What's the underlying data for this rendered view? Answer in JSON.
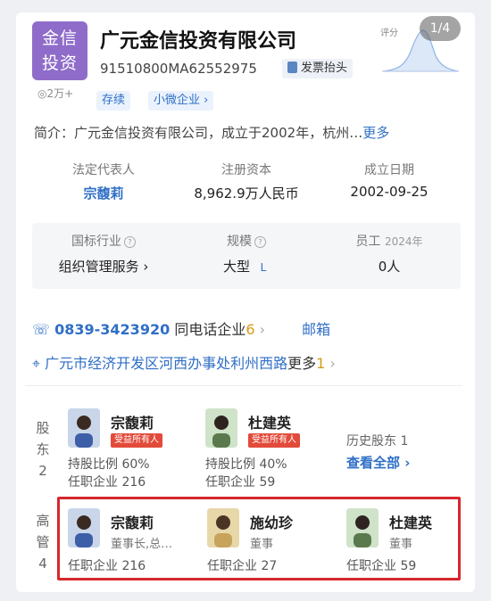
{
  "logo": {
    "line1": "金信",
    "line2": "投资",
    "color": "#8f6cc9"
  },
  "company": {
    "name": "广元金信投资有限公司",
    "credit_code": "91510800MA62552975",
    "invoice_label": "发票抬头",
    "score_label": "评分",
    "page_indicator": "1/4",
    "views": "2万+",
    "tags": [
      "存续",
      "小微企业"
    ],
    "intro_prefix": "简介：",
    "intro_text": "广元金信投资有限公司，成立于2002年，杭州…",
    "intro_more": "更多"
  },
  "info_grid": [
    {
      "label": "法定代表人",
      "value": "宗馥莉",
      "link": true
    },
    {
      "label": "注册资本",
      "value": "8,962.9万人民币"
    },
    {
      "label": "成立日期",
      "value": "2002-09-25"
    }
  ],
  "info_grid2": [
    {
      "label": "国标行业",
      "value": "组织管理服务"
    },
    {
      "label": "规模",
      "value": "大型",
      "badge": "L"
    },
    {
      "label": "员工",
      "sub": "2024年",
      "value": "0人"
    }
  ],
  "contact": {
    "phone": "0839-3423920",
    "same_phone_label": "同电话企业",
    "same_phone_count": "6",
    "email_label": "邮箱",
    "address": "广元市经济开发区河西办事处利州西路",
    "address_more": "更多",
    "address_more_count": "1"
  },
  "shareholders": {
    "label": [
      "股",
      "东",
      "2"
    ],
    "people": [
      {
        "name": "宗馥莉",
        "role": "受益所有人",
        "ratio_label": "持股比例",
        "ratio": "60%",
        "company_label": "任职企业",
        "company_count": "216"
      },
      {
        "name": "杜建英",
        "role": "受益所有人",
        "ratio_label": "持股比例",
        "ratio": "40%",
        "company_label": "任职企业",
        "company_count": "59"
      }
    ],
    "history_label": "历史股东",
    "history_count": "1",
    "view_all": "查看全部"
  },
  "executives": {
    "label": [
      "高",
      "管",
      "4"
    ],
    "people": [
      {
        "name": "宗馥莉",
        "role": "董事长,总…",
        "company_label": "任职企业",
        "company_count": "216"
      },
      {
        "name": "施幼珍",
        "role": "董事",
        "company_label": "任职企业",
        "company_count": "27"
      },
      {
        "name": "杜建英",
        "role": "董事",
        "company_label": "任职企业",
        "company_count": "59"
      }
    ]
  }
}
